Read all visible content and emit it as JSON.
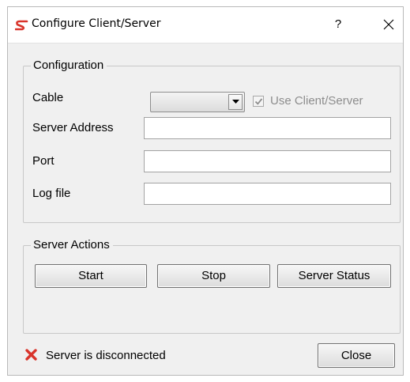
{
  "window": {
    "title": "Configure Client/Server",
    "help_label": "?",
    "close_glyph": "✕"
  },
  "configuration": {
    "group_title": "Configuration",
    "cable": {
      "label": "Cable",
      "value": ""
    },
    "use_client_server": {
      "label": "Use Client/Server",
      "checked": true,
      "enabled": false
    },
    "server_address": {
      "label": "Server Address",
      "value": ""
    },
    "port": {
      "label": "Port",
      "value": ""
    },
    "log_file": {
      "label": "Log file",
      "value": ""
    }
  },
  "server_actions": {
    "group_title": "Server Actions",
    "start_label": "Start",
    "stop_label": "Stop",
    "status_label": "Server Status"
  },
  "footer": {
    "status_text": "Server is disconnected",
    "status_icon": "red-x-icon",
    "close_label": "Close"
  },
  "colors": {
    "accent_red": "#d9342b",
    "dialog_bg": "#f0f0f0",
    "disabled_text": "#8d8d8d"
  }
}
